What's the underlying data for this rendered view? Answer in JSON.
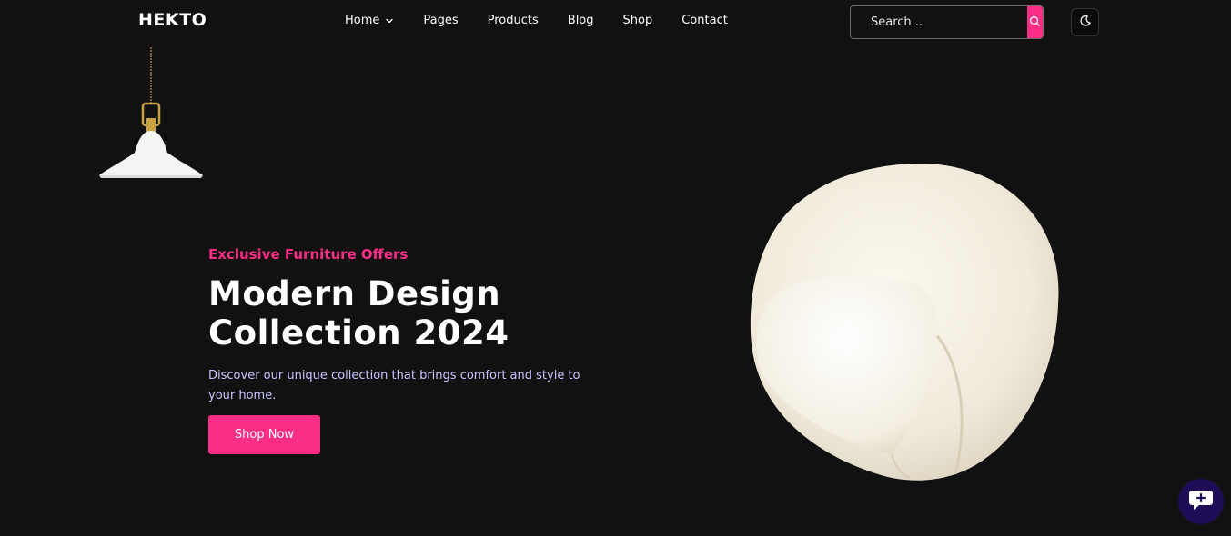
{
  "header": {
    "logo": "HEKTO",
    "nav": [
      {
        "label": "Home",
        "has_dropdown": true
      },
      {
        "label": "Pages"
      },
      {
        "label": "Products"
      },
      {
        "label": "Blog"
      },
      {
        "label": "Shop"
      },
      {
        "label": "Contact"
      }
    ],
    "search": {
      "placeholder": "Search..."
    },
    "icons": {
      "search_button": "search-icon",
      "theme_toggle": "moon-icon"
    }
  },
  "hero": {
    "kicker": "Exclusive Furniture Offers",
    "headline_line1": "Modern Design",
    "headline_line2": "Collection 2024",
    "description": "Discover our unique collection that brings comfort and style to your home.",
    "cta_label": "Shop Now"
  },
  "widgets": {
    "chat_icon": "chat-bubble-icon"
  },
  "colors": {
    "background": "#111111",
    "accent": "#fb2e86",
    "description_text": "#c9c6ff",
    "chat_button": "#1f0d55"
  }
}
